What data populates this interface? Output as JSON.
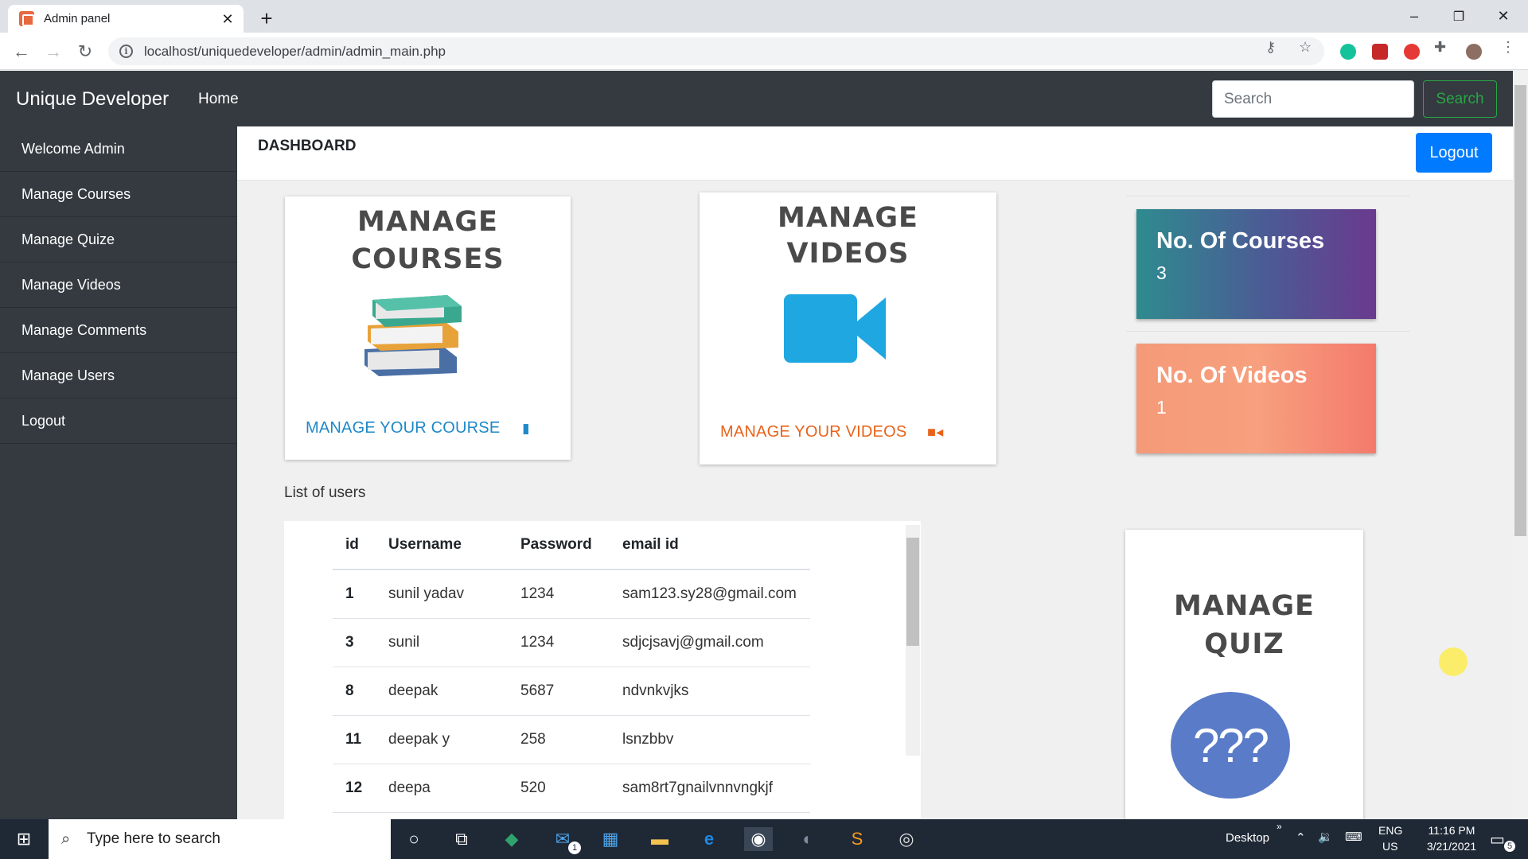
{
  "browser": {
    "tab_title": "Admin panel",
    "tab_close": "✕",
    "new_tab": "+",
    "url": "localhost/uniquedeveloper/admin/admin_main.php",
    "window_controls": [
      "–",
      "❐",
      "✕"
    ]
  },
  "navbar": {
    "brand": "Unique Developer",
    "home": "Home",
    "search_placeholder": "Search",
    "search_button": "Search"
  },
  "sidebar": {
    "items": [
      {
        "label": "Welcome Admin"
      },
      {
        "label": "Manage Courses"
      },
      {
        "label": "Manage Quize"
      },
      {
        "label": "Manage Videos"
      },
      {
        "label": "Manage Comments"
      },
      {
        "label": "Manage Users"
      },
      {
        "label": "Logout"
      }
    ]
  },
  "dashboard": {
    "title": "DASHBOARD",
    "logout": "Logout"
  },
  "cards": {
    "courses": {
      "heading_1": "MANAGE",
      "heading_2": "COURSES",
      "link": "MANAGE YOUR COURSE",
      "link_color": "#1e88c8"
    },
    "videos": {
      "heading_1": "MANAGE",
      "heading_2": "VIDEOS",
      "link": "MANAGE YOUR VIDEOS",
      "link_color": "#e8631a"
    },
    "quiz": {
      "heading_1": "MANAGE",
      "heading_2": "QUIZ",
      "icon_text": "???"
    }
  },
  "stats": {
    "courses": {
      "label": "No. Of Courses",
      "value": "3"
    },
    "videos": {
      "label": "No. Of Videos",
      "value": "1"
    }
  },
  "users": {
    "title": "List of users",
    "columns": [
      "id",
      "Username",
      "Password",
      "email id"
    ],
    "rows": [
      {
        "id": "1",
        "username": "sunil yadav",
        "password": "1234",
        "email": "sam123.sy28@gmail.com"
      },
      {
        "id": "3",
        "username": "sunil",
        "password": "1234",
        "email": "sdjcjsavj@gmail.com"
      },
      {
        "id": "8",
        "username": "deepak",
        "password": "5687",
        "email": "ndvnkvjks"
      },
      {
        "id": "11",
        "username": "deepak y",
        "password": "258",
        "email": "lsnzbbv"
      },
      {
        "id": "12",
        "username": "deepa",
        "password": "520",
        "email": "sam8rt7gnailvnnvngkjf"
      }
    ]
  },
  "taskbar": {
    "search_placeholder": "Type here to search",
    "desktop": "Desktop",
    "lang": "ENG",
    "region": "US",
    "time": "11:16 PM",
    "date": "3/21/2021",
    "notification_count": "5",
    "mail_badge": "1"
  },
  "colors": {
    "navbar_bg": "#343a40",
    "primary": "#007bff",
    "success": "#28a745"
  }
}
